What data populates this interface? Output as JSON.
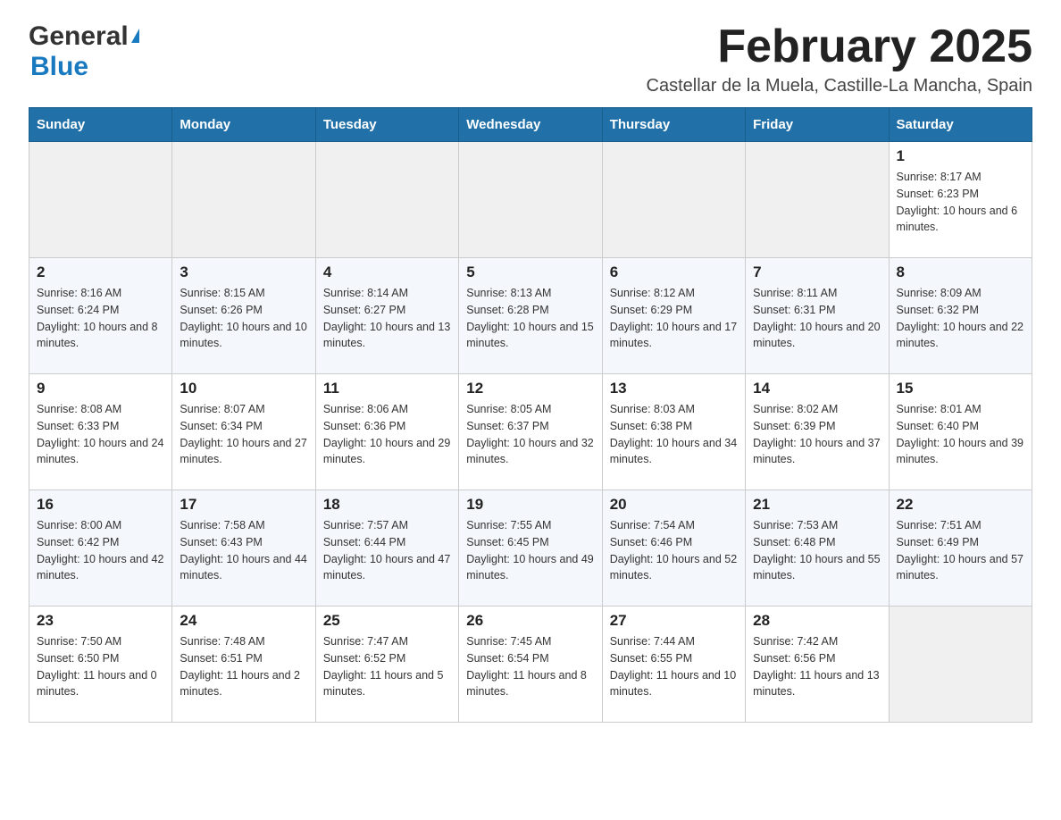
{
  "header": {
    "logo_general": "General",
    "logo_blue": "Blue",
    "month_title": "February 2025",
    "subtitle": "Castellar de la Muela, Castille-La Mancha, Spain"
  },
  "days_of_week": [
    "Sunday",
    "Monday",
    "Tuesday",
    "Wednesday",
    "Thursday",
    "Friday",
    "Saturday"
  ],
  "weeks": [
    {
      "days": [
        {
          "number": "",
          "info": "",
          "empty": true
        },
        {
          "number": "",
          "info": "",
          "empty": true
        },
        {
          "number": "",
          "info": "",
          "empty": true
        },
        {
          "number": "",
          "info": "",
          "empty": true
        },
        {
          "number": "",
          "info": "",
          "empty": true
        },
        {
          "number": "",
          "info": "",
          "empty": true
        },
        {
          "number": "1",
          "info": "Sunrise: 8:17 AM\nSunset: 6:23 PM\nDaylight: 10 hours and 6 minutes.",
          "empty": false
        }
      ]
    },
    {
      "days": [
        {
          "number": "2",
          "info": "Sunrise: 8:16 AM\nSunset: 6:24 PM\nDaylight: 10 hours and 8 minutes.",
          "empty": false
        },
        {
          "number": "3",
          "info": "Sunrise: 8:15 AM\nSunset: 6:26 PM\nDaylight: 10 hours and 10 minutes.",
          "empty": false
        },
        {
          "number": "4",
          "info": "Sunrise: 8:14 AM\nSunset: 6:27 PM\nDaylight: 10 hours and 13 minutes.",
          "empty": false
        },
        {
          "number": "5",
          "info": "Sunrise: 8:13 AM\nSunset: 6:28 PM\nDaylight: 10 hours and 15 minutes.",
          "empty": false
        },
        {
          "number": "6",
          "info": "Sunrise: 8:12 AM\nSunset: 6:29 PM\nDaylight: 10 hours and 17 minutes.",
          "empty": false
        },
        {
          "number": "7",
          "info": "Sunrise: 8:11 AM\nSunset: 6:31 PM\nDaylight: 10 hours and 20 minutes.",
          "empty": false
        },
        {
          "number": "8",
          "info": "Sunrise: 8:09 AM\nSunset: 6:32 PM\nDaylight: 10 hours and 22 minutes.",
          "empty": false
        }
      ]
    },
    {
      "days": [
        {
          "number": "9",
          "info": "Sunrise: 8:08 AM\nSunset: 6:33 PM\nDaylight: 10 hours and 24 minutes.",
          "empty": false
        },
        {
          "number": "10",
          "info": "Sunrise: 8:07 AM\nSunset: 6:34 PM\nDaylight: 10 hours and 27 minutes.",
          "empty": false
        },
        {
          "number": "11",
          "info": "Sunrise: 8:06 AM\nSunset: 6:36 PM\nDaylight: 10 hours and 29 minutes.",
          "empty": false
        },
        {
          "number": "12",
          "info": "Sunrise: 8:05 AM\nSunset: 6:37 PM\nDaylight: 10 hours and 32 minutes.",
          "empty": false
        },
        {
          "number": "13",
          "info": "Sunrise: 8:03 AM\nSunset: 6:38 PM\nDaylight: 10 hours and 34 minutes.",
          "empty": false
        },
        {
          "number": "14",
          "info": "Sunrise: 8:02 AM\nSunset: 6:39 PM\nDaylight: 10 hours and 37 minutes.",
          "empty": false
        },
        {
          "number": "15",
          "info": "Sunrise: 8:01 AM\nSunset: 6:40 PM\nDaylight: 10 hours and 39 minutes.",
          "empty": false
        }
      ]
    },
    {
      "days": [
        {
          "number": "16",
          "info": "Sunrise: 8:00 AM\nSunset: 6:42 PM\nDaylight: 10 hours and 42 minutes.",
          "empty": false
        },
        {
          "number": "17",
          "info": "Sunrise: 7:58 AM\nSunset: 6:43 PM\nDaylight: 10 hours and 44 minutes.",
          "empty": false
        },
        {
          "number": "18",
          "info": "Sunrise: 7:57 AM\nSunset: 6:44 PM\nDaylight: 10 hours and 47 minutes.",
          "empty": false
        },
        {
          "number": "19",
          "info": "Sunrise: 7:55 AM\nSunset: 6:45 PM\nDaylight: 10 hours and 49 minutes.",
          "empty": false
        },
        {
          "number": "20",
          "info": "Sunrise: 7:54 AM\nSunset: 6:46 PM\nDaylight: 10 hours and 52 minutes.",
          "empty": false
        },
        {
          "number": "21",
          "info": "Sunrise: 7:53 AM\nSunset: 6:48 PM\nDaylight: 10 hours and 55 minutes.",
          "empty": false
        },
        {
          "number": "22",
          "info": "Sunrise: 7:51 AM\nSunset: 6:49 PM\nDaylight: 10 hours and 57 minutes.",
          "empty": false
        }
      ]
    },
    {
      "days": [
        {
          "number": "23",
          "info": "Sunrise: 7:50 AM\nSunset: 6:50 PM\nDaylight: 11 hours and 0 minutes.",
          "empty": false
        },
        {
          "number": "24",
          "info": "Sunrise: 7:48 AM\nSunset: 6:51 PM\nDaylight: 11 hours and 2 minutes.",
          "empty": false
        },
        {
          "number": "25",
          "info": "Sunrise: 7:47 AM\nSunset: 6:52 PM\nDaylight: 11 hours and 5 minutes.",
          "empty": false
        },
        {
          "number": "26",
          "info": "Sunrise: 7:45 AM\nSunset: 6:54 PM\nDaylight: 11 hours and 8 minutes.",
          "empty": false
        },
        {
          "number": "27",
          "info": "Sunrise: 7:44 AM\nSunset: 6:55 PM\nDaylight: 11 hours and 10 minutes.",
          "empty": false
        },
        {
          "number": "28",
          "info": "Sunrise: 7:42 AM\nSunset: 6:56 PM\nDaylight: 11 hours and 13 minutes.",
          "empty": false
        },
        {
          "number": "",
          "info": "",
          "empty": true
        }
      ]
    }
  ]
}
